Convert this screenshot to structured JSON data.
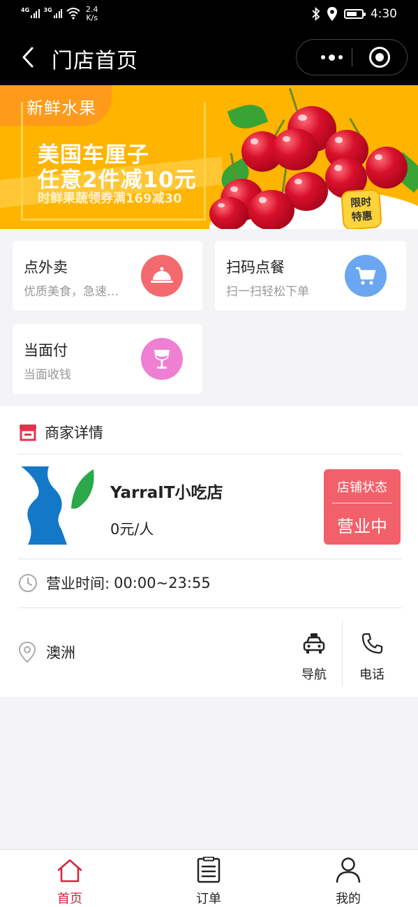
{
  "status_bar": {
    "sim1": "4G",
    "sim2": "3G",
    "speed_value": "2.4",
    "speed_unit": "K/s",
    "time": "4:30",
    "battery_level": 0.7
  },
  "nav": {
    "title": "门店首页"
  },
  "banner": {
    "tag": "新鲜水果",
    "headline_1": "美国车厘子",
    "headline_2": "任意2件减10元",
    "subline": "时鲜果蔬领券满169减30",
    "badge_1": "限时",
    "badge_2": "特惠"
  },
  "services": [
    {
      "title": "点外卖",
      "desc": "优质美食，急速…",
      "icon": "cloche-icon",
      "color": "#f26a6e"
    },
    {
      "title": "扫码点餐",
      "desc": "扫一扫轻松下单",
      "icon": "cart-icon",
      "color": "#6aa7f0"
    },
    {
      "title": "当面付",
      "desc": "当面收钱",
      "icon": "glass-icon",
      "color": "#ef7fd2"
    }
  ],
  "merchant": {
    "section_title": "商家详情",
    "name": "YarraIT小吃店",
    "price": "0元/人",
    "status_label": "店铺状态",
    "status_value": "营业中",
    "hours_label": "营业时间:",
    "hours_value": "00:00~23:55",
    "address": "澳洲",
    "navigate_label": "导航",
    "phone_label": "电话"
  },
  "tabs": [
    {
      "label": "首页",
      "icon": "home-icon",
      "active": true
    },
    {
      "label": "订单",
      "icon": "order-list-icon",
      "active": false
    },
    {
      "label": "我的",
      "icon": "user-icon",
      "active": false
    }
  ],
  "colors": {
    "accent": "#d8223c",
    "status_box": "#f2606a",
    "banner": "#ffb400"
  }
}
